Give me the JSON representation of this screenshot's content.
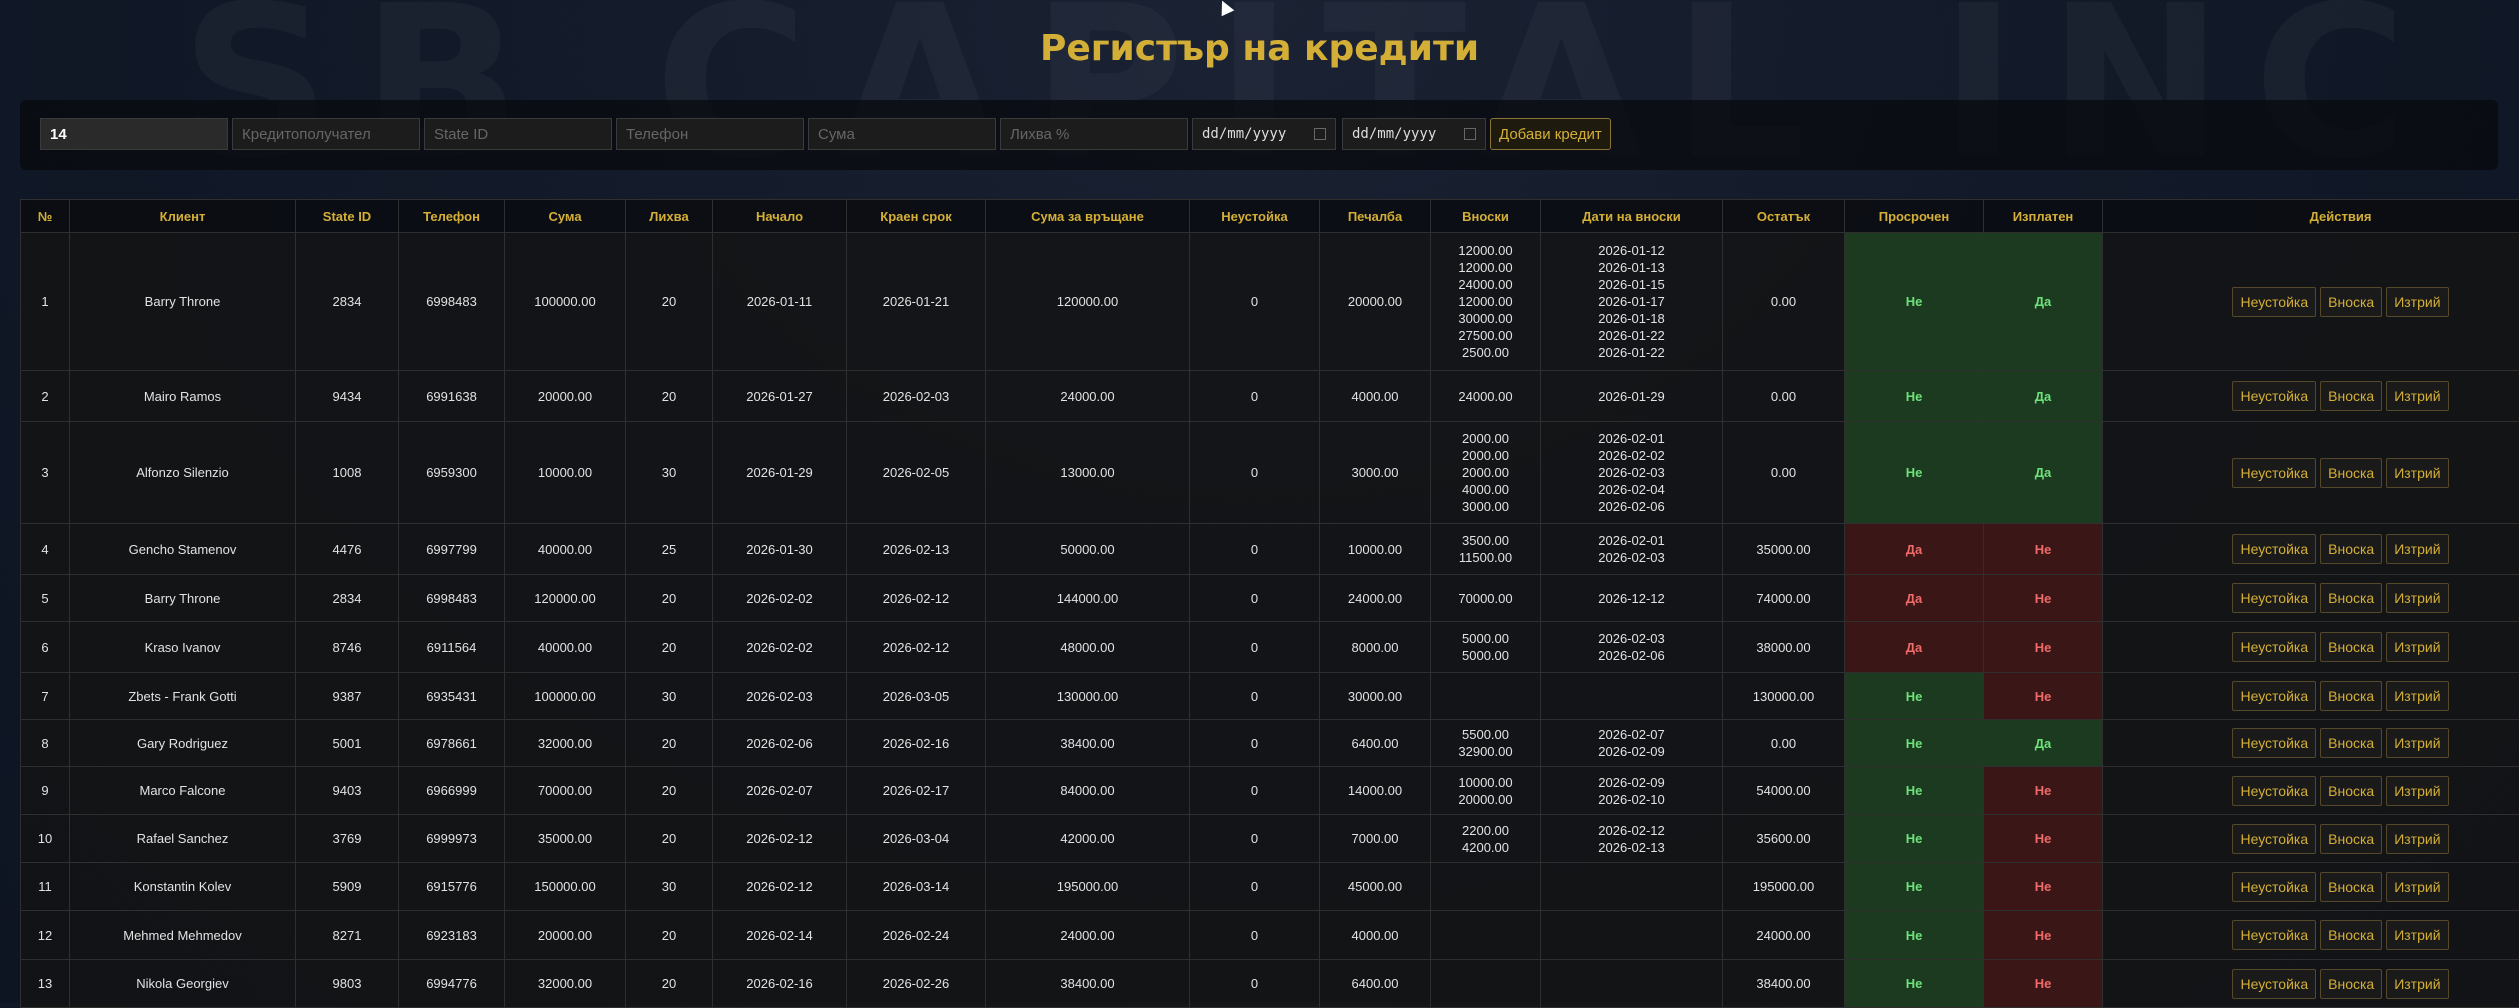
{
  "watermark": "SB CAPITAL INC",
  "title": "Регистър на кредити",
  "form": {
    "id_value": "14",
    "borrower_placeholder": "Кредитополучател",
    "stateid_placeholder": "State ID",
    "phone_placeholder": "Телефон",
    "amount_placeholder": "Сума",
    "interest_placeholder": "Лихва %",
    "date_placeholder": "dd/mm/yyyy",
    "add_button": "Добави кредит"
  },
  "table": {
    "headers": [
      "№",
      "Клиент",
      "State ID",
      "Телефон",
      "Сума",
      "Лихва",
      "Начало",
      "Краен срок",
      "Сума за връщане",
      "Неустойка",
      "Печалба",
      "Вноски",
      "Дати на вноски",
      "Остатък",
      "Просрочен",
      "Изплатен",
      "Действия"
    ],
    "actions": {
      "penalty": "Неустойка",
      "payment": "Вноска",
      "delete": "Изтрий"
    },
    "rows": [
      {
        "no": "1",
        "client": "Barry Throne",
        "state_id": "2834",
        "phone": "6998483",
        "amount": "100000.00",
        "interest": "20",
        "start": "2026-01-11",
        "due": "2026-01-21",
        "to_return": "120000.00",
        "penalty": "0",
        "profit": "20000.00",
        "payments": [
          "12000.00",
          "12000.00",
          "24000.00",
          "12000.00",
          "30000.00",
          "27500.00",
          "2500.00"
        ],
        "payment_dates": [
          "2026-01-12",
          "2026-01-13",
          "2026-01-15",
          "2026-01-17",
          "2026-01-18",
          "2026-01-22",
          "2026-01-22"
        ],
        "remaining": "0.00",
        "overdue": "Не",
        "paid": "Да"
      },
      {
        "no": "2",
        "client": "Mairo Ramos",
        "state_id": "9434",
        "phone": "6991638",
        "amount": "20000.00",
        "interest": "20",
        "start": "2026-01-27",
        "due": "2026-02-03",
        "to_return": "24000.00",
        "penalty": "0",
        "profit": "4000.00",
        "payments": [
          "24000.00"
        ],
        "payment_dates": [
          "2026-01-29"
        ],
        "remaining": "0.00",
        "overdue": "Не",
        "paid": "Да"
      },
      {
        "no": "3",
        "client": "Alfonzo Silenzio",
        "state_id": "1008",
        "phone": "6959300",
        "amount": "10000.00",
        "interest": "30",
        "start": "2026-01-29",
        "due": "2026-02-05",
        "to_return": "13000.00",
        "penalty": "0",
        "profit": "3000.00",
        "payments": [
          "2000.00",
          "2000.00",
          "2000.00",
          "4000.00",
          "3000.00"
        ],
        "payment_dates": [
          "2026-02-01",
          "2026-02-02",
          "2026-02-03",
          "2026-02-04",
          "2026-02-06"
        ],
        "remaining": "0.00",
        "overdue": "Не",
        "paid": "Да"
      },
      {
        "no": "4",
        "client": "Gencho Stamenov",
        "state_id": "4476",
        "phone": "6997799",
        "amount": "40000.00",
        "interest": "25",
        "start": "2026-01-30",
        "due": "2026-02-13",
        "to_return": "50000.00",
        "penalty": "0",
        "profit": "10000.00",
        "payments": [
          "3500.00",
          "11500.00"
        ],
        "payment_dates": [
          "2026-02-01",
          "2026-02-03"
        ],
        "remaining": "35000.00",
        "overdue": "Да",
        "paid": "Не"
      },
      {
        "no": "5",
        "client": "Barry Throne",
        "state_id": "2834",
        "phone": "6998483",
        "amount": "120000.00",
        "interest": "20",
        "start": "2026-02-02",
        "due": "2026-02-12",
        "to_return": "144000.00",
        "penalty": "0",
        "profit": "24000.00",
        "payments": [
          "70000.00"
        ],
        "payment_dates": [
          "2026-12-12"
        ],
        "remaining": "74000.00",
        "overdue": "Да",
        "paid": "Не"
      },
      {
        "no": "6",
        "client": "Kraso Ivanov",
        "state_id": "8746",
        "phone": "6911564",
        "amount": "40000.00",
        "interest": "20",
        "start": "2026-02-02",
        "due": "2026-02-12",
        "to_return": "48000.00",
        "penalty": "0",
        "profit": "8000.00",
        "payments": [
          "5000.00",
          "5000.00"
        ],
        "payment_dates": [
          "2026-02-03",
          "2026-02-06"
        ],
        "remaining": "38000.00",
        "overdue": "Да",
        "paid": "Не"
      },
      {
        "no": "7",
        "client": "Zbets - Frank Gotti",
        "state_id": "9387",
        "phone": "6935431",
        "amount": "100000.00",
        "interest": "30",
        "start": "2026-02-03",
        "due": "2026-03-05",
        "to_return": "130000.00",
        "penalty": "0",
        "profit": "30000.00",
        "payments": [],
        "payment_dates": [],
        "remaining": "130000.00",
        "overdue": "Не",
        "paid": "Не"
      },
      {
        "no": "8",
        "client": "Gary Rodriguez",
        "state_id": "5001",
        "phone": "6978661",
        "amount": "32000.00",
        "interest": "20",
        "start": "2026-02-06",
        "due": "2026-02-16",
        "to_return": "38400.00",
        "penalty": "0",
        "profit": "6400.00",
        "payments": [
          "5500.00",
          "32900.00"
        ],
        "payment_dates": [
          "2026-02-07",
          "2026-02-09"
        ],
        "remaining": "0.00",
        "overdue": "Не",
        "paid": "Да"
      },
      {
        "no": "9",
        "client": "Marco Falcone",
        "state_id": "9403",
        "phone": "6966999",
        "amount": "70000.00",
        "interest": "20",
        "start": "2026-02-07",
        "due": "2026-02-17",
        "to_return": "84000.00",
        "penalty": "0",
        "profit": "14000.00",
        "payments": [
          "10000.00",
          "20000.00"
        ],
        "payment_dates": [
          "2026-02-09",
          "2026-02-10"
        ],
        "remaining": "54000.00",
        "overdue": "Не",
        "paid": "Не"
      },
      {
        "no": "10",
        "client": "Rafael Sanchez",
        "state_id": "3769",
        "phone": "6999973",
        "amount": "35000.00",
        "interest": "20",
        "start": "2026-02-12",
        "due": "2026-03-04",
        "to_return": "42000.00",
        "penalty": "0",
        "profit": "7000.00",
        "payments": [
          "2200.00",
          "4200.00"
        ],
        "payment_dates": [
          "2026-02-12",
          "2026-02-13"
        ],
        "remaining": "35600.00",
        "overdue": "Не",
        "paid": "Не"
      },
      {
        "no": "11",
        "client": "Konstantin Kolev",
        "state_id": "5909",
        "phone": "6915776",
        "amount": "150000.00",
        "interest": "30",
        "start": "2026-02-12",
        "due": "2026-03-14",
        "to_return": "195000.00",
        "penalty": "0",
        "profit": "45000.00",
        "payments": [],
        "payment_dates": [],
        "remaining": "195000.00",
        "overdue": "Не",
        "paid": "Не"
      },
      {
        "no": "12",
        "client": "Mehmed Mehmedov",
        "state_id": "8271",
        "phone": "6923183",
        "amount": "20000.00",
        "interest": "20",
        "start": "2026-02-14",
        "due": "2026-02-24",
        "to_return": "24000.00",
        "penalty": "0",
        "profit": "4000.00",
        "payments": [],
        "payment_dates": [],
        "remaining": "24000.00",
        "overdue": "Не",
        "paid": "Не"
      },
      {
        "no": "13",
        "client": "Nikola Georgiev",
        "state_id": "9803",
        "phone": "6994776",
        "amount": "32000.00",
        "interest": "20",
        "start": "2026-02-16",
        "due": "2026-02-26",
        "to_return": "38400.00",
        "penalty": "0",
        "profit": "6400.00",
        "payments": [],
        "payment_dates": [],
        "remaining": "38400.00",
        "overdue": "Не",
        "paid": "Не"
      }
    ]
  },
  "colors": {
    "accent": "#d4af37",
    "yes_green": "#1b3a20",
    "no_red": "#3b1616"
  }
}
